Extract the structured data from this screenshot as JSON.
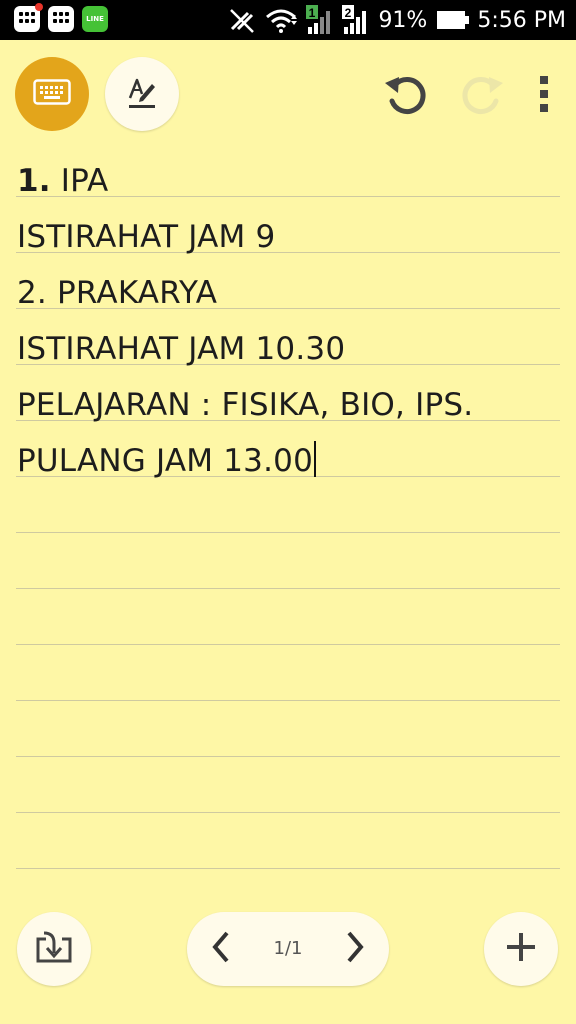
{
  "status_bar": {
    "battery_text": "91%",
    "time": "5:56 PM",
    "sim1_label": "1",
    "sim2_label": "2",
    "line_app_label": "LINE",
    "icons": [
      "bbm-notification-icon",
      "bbm-icon",
      "line-app-icon",
      "no-sync-icon",
      "wifi-icon",
      "signal-sim1-icon",
      "signal-sim2-icon",
      "battery-icon"
    ]
  },
  "toolbar": {
    "icons": [
      "keyboard-icon",
      "handwriting-icon",
      "undo-icon",
      "redo-icon",
      "more-vert-icon"
    ]
  },
  "note": {
    "lines": [
      {
        "prefix": "1.",
        "text": " IPA"
      },
      {
        "prefix": "",
        "text": "ISTIRAHAT JAM 9"
      },
      {
        "prefix": "",
        "text": "2. PRAKARYA"
      },
      {
        "prefix": "",
        "text": "ISTIRAHAT JAM 10.30"
      },
      {
        "prefix": "",
        "text": "PELAJARAN : FISIKA, BIO, IPS."
      },
      {
        "prefix": "",
        "text": "PULANG JAM 13.00"
      }
    ]
  },
  "bottom_bar": {
    "page_indicator": "1/1",
    "icons": [
      "import-icon",
      "chevron-left-icon",
      "chevron-right-icon",
      "add-icon"
    ]
  },
  "colors": {
    "paper": "#fef7a6",
    "accent": "#e3a51b",
    "button_bg": "#fffbea",
    "rule": "#cfcaa0",
    "status_bar": "#000000"
  }
}
